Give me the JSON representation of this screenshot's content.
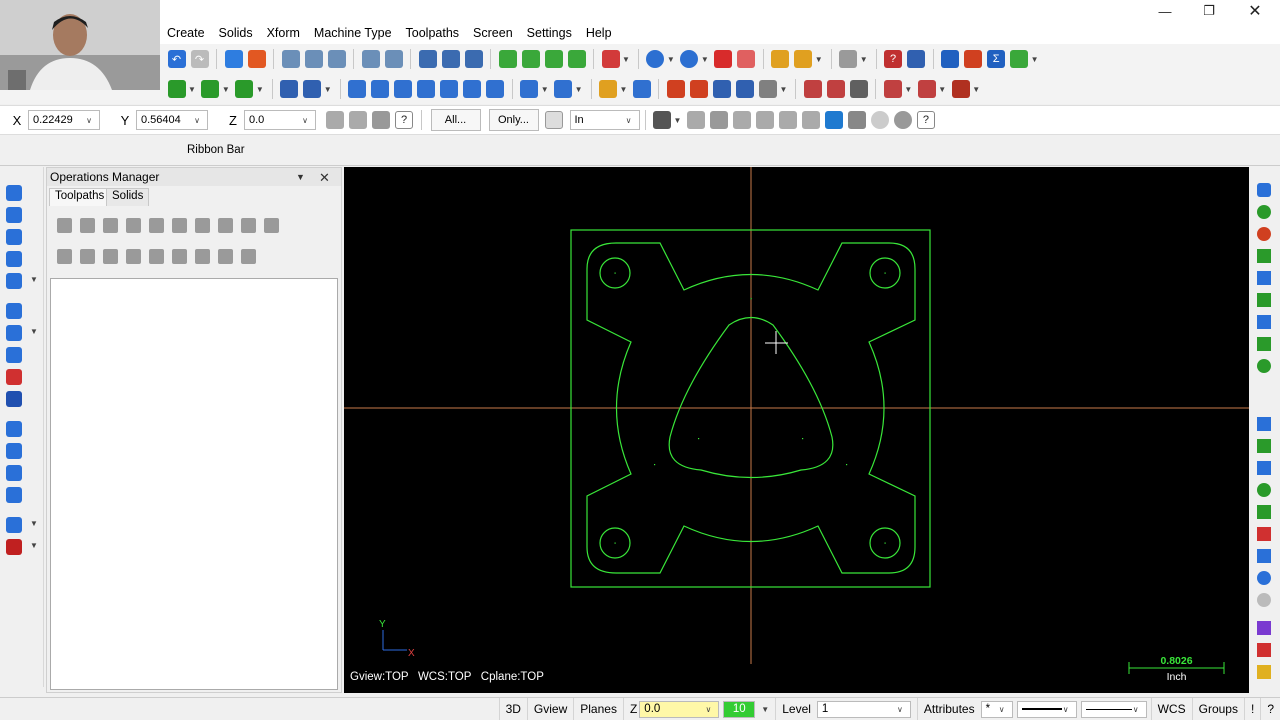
{
  "menu": {
    "items": [
      "Create",
      "Solids",
      "Xform",
      "Machine Type",
      "Toolpaths",
      "Screen",
      "Settings",
      "Help"
    ]
  },
  "coords": {
    "x_label": "X",
    "x_value": "0.22429",
    "y_label": "Y",
    "y_value": "0.56404",
    "z_label": "Z",
    "z_value": "0.0",
    "all_label": "All...",
    "only_label": "Only...",
    "unit_value": "In"
  },
  "ribbon": {
    "label": "Ribbon Bar"
  },
  "ops": {
    "title": "Operations Manager",
    "tab_toolpaths": "Toolpaths",
    "tab_solids": "Solids"
  },
  "viewport": {
    "view_info": "Gview:TOP   WCS:TOP   Cplane:TOP",
    "axis_y": "Y",
    "axis_x": "X",
    "scale_value": "0.8026",
    "scale_unit": "Inch",
    "geometry_color": "#39e639",
    "axis_color": "#c87a4a"
  },
  "status": {
    "mode_3d": "3D",
    "gview": "Gview",
    "planes": "Planes",
    "z_label": "Z",
    "z_value": "0.0",
    "color_value": "10",
    "level_label": "Level",
    "level_value": "1",
    "attributes": "Attributes",
    "point_style": "*",
    "wcs": "WCS",
    "groups": "Groups",
    "help_mark": "!",
    "q_mark": "?"
  }
}
